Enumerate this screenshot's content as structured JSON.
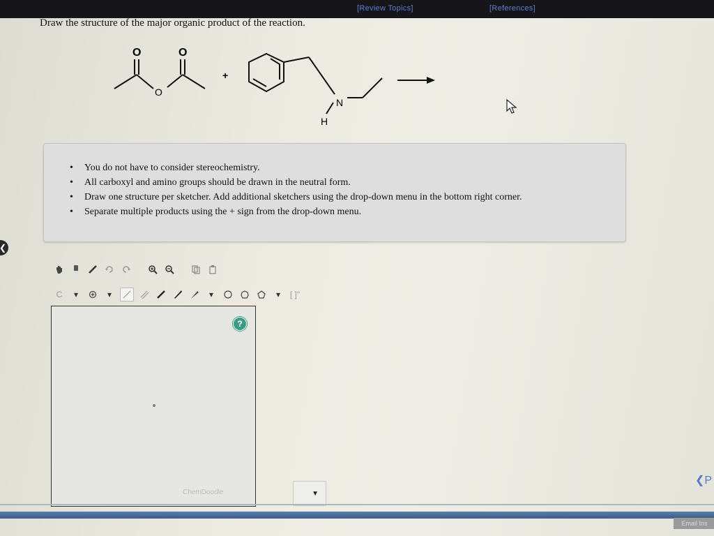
{
  "header": {
    "review_topics": "[Review Topics]",
    "references": "[References]"
  },
  "question": {
    "prompt": "Draw the structure of the major organic product of the reaction."
  },
  "reaction": {
    "plus_sign": "+",
    "reagent1_atoms": {
      "o_top_left": "O",
      "o_top_right": "O",
      "o_bridge": "O"
    },
    "reagent2_atoms": {
      "n": "N",
      "h": "H"
    }
  },
  "instructions": {
    "items": [
      "You do not have to consider stereochemistry.",
      "All carboxyl and amino groups should be drawn in the neutral form.",
      "Draw one structure per sketcher. Add additional sketchers using the drop-down menu in the bottom right corner.",
      "Separate multiple products using the + sign from the drop-down menu."
    ]
  },
  "toolbar2": {
    "element_label": "C",
    "bracket_label": "[ ]\""
  },
  "sketcher": {
    "help_label": "?",
    "watermark": "ChemDoodle"
  },
  "dropdown": {
    "caret": "▼"
  },
  "nav": {
    "prev_label": "❮P"
  },
  "footer": {
    "email_label": "Email Ins"
  },
  "colors": {
    "topbar": "#15151a",
    "link": "#5b7fd0",
    "help_icon": "#3c9a86",
    "instructions_bg": "#dddedd",
    "bottom_bar": "#4a6d96"
  },
  "icons": [
    "hand-icon",
    "eraser-icon",
    "pencil-icon",
    "undo-icon",
    "redo-icon",
    "zoom-in-icon",
    "zoom-out-icon",
    "copy-icon",
    "paste-icon",
    "charge-icon",
    "single-bond-icon",
    "double-bond-icon",
    "triple-bond-icon",
    "wedge-bond-icon",
    "hexagon-ring-icon",
    "heptagon-ring-icon",
    "pentagon-ring-icon",
    "cursor-icon",
    "help-icon",
    "chevron-left-icon",
    "dropdown-caret-icon"
  ]
}
